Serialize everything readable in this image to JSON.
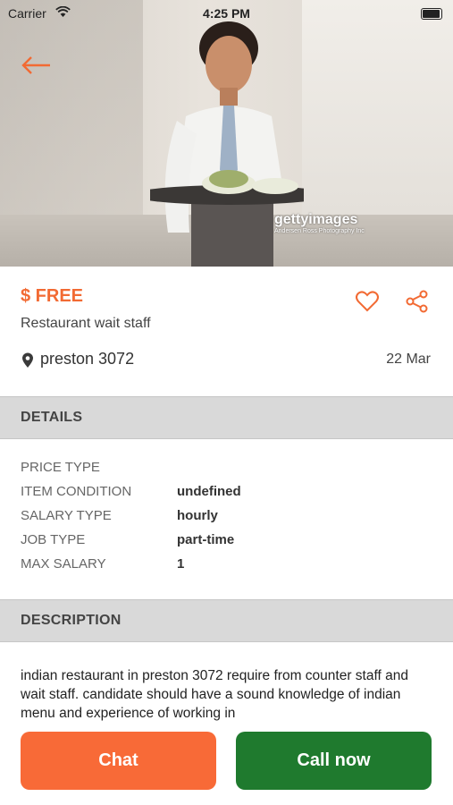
{
  "status_bar": {
    "carrier": "Carrier",
    "time": "4:25 PM"
  },
  "hero": {
    "watermark": "gettyimages",
    "watermark_credit": "Andersen Ross Photography Inc"
  },
  "listing": {
    "price": "$ FREE",
    "title": "Restaurant wait staff",
    "location": "preston 3072",
    "date": "22 Mar"
  },
  "details": {
    "heading": "DETAILS",
    "rows": [
      {
        "label": "PRICE TYPE",
        "value": ""
      },
      {
        "label": "ITEM CONDITION",
        "value": "undefined"
      },
      {
        "label": "SALARY TYPE",
        "value": "hourly"
      },
      {
        "label": "JOB TYPE",
        "value": "part-time"
      },
      {
        "label": "MAX SALARY",
        "value": "1"
      }
    ]
  },
  "description": {
    "heading": "DESCRIPTION",
    "text": "indian restaurant in preston 3072 require from counter staff and wait staff. candidate should have a sound knowledge of indian menu and experience of working in"
  },
  "actions": {
    "chat_label": "Chat",
    "call_label": "Call now"
  },
  "colors": {
    "accent": "#f26a33",
    "chat": "#f86a37",
    "call": "#1f7a2e",
    "section_bg": "#d9d9d9"
  },
  "icons": [
    "back-arrow-icon",
    "wifi-icon",
    "battery-icon",
    "heart-icon",
    "share-icon",
    "location-pin-icon"
  ]
}
